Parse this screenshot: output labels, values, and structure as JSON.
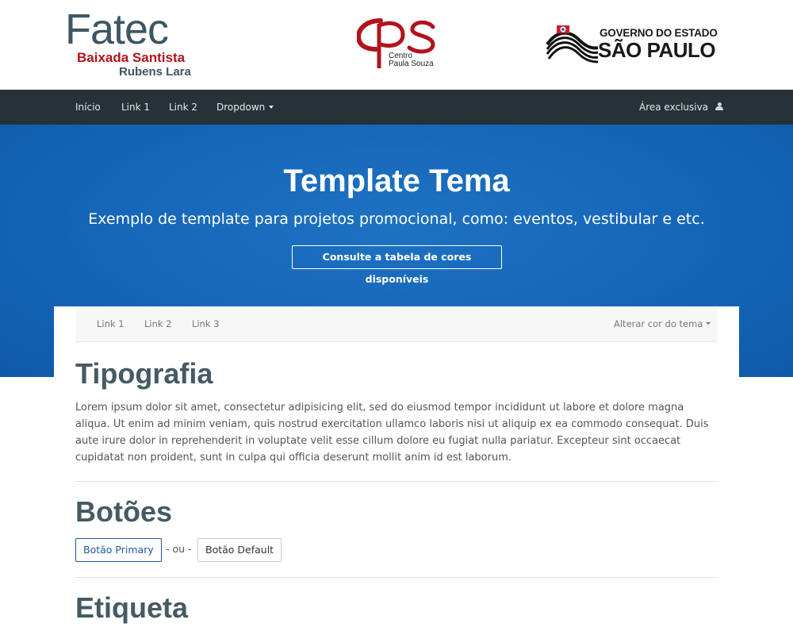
{
  "header": {
    "fatec_logo": {
      "word": "Fatec",
      "line1": "Baixada Santista",
      "line2": "Rubens Lara"
    },
    "cps_logo": {
      "line1": "Centro",
      "line2": "Paula Souza"
    },
    "sp_logo": {
      "line1": "GOVERNO DO ESTADO",
      "line2": "SÃO PAULO"
    }
  },
  "navbar": {
    "items": [
      {
        "label": "Início"
      },
      {
        "label": "Link 1"
      },
      {
        "label": "Link 2"
      },
      {
        "label": "Dropdown"
      }
    ],
    "right_label": "Área exclusiva"
  },
  "hero": {
    "title": "Template Tema",
    "subtitle": "Exemplo de template para projetos promocional, como: eventos, vestibular e etc.",
    "button_label": "Consulte a tabela de cores disponíveis"
  },
  "subnav": {
    "items": [
      {
        "label": "Link 1"
      },
      {
        "label": "Link 2"
      },
      {
        "label": "Link 3"
      }
    ],
    "right_label": "Alterar cor do tema"
  },
  "sections": {
    "tipografia": {
      "title": "Tipografia",
      "text": "Lorem ipsum dolor sit amet, consectetur adipisicing elit, sed do eiusmod tempor incididunt ut labore et dolore magna aliqua. Ut enim ad minim veniam, quis nostrud exercitation ullamco laboris nisi ut aliquip ex ea commodo consequat. Duis aute irure dolor in reprehenderit in voluptate velit esse cillum dolore eu fugiat nulla pariatur. Excepteur sint occaecat cupidatat non proident, sunt in culpa qui officia deserunt mollit anim id est laborum."
    },
    "botoes": {
      "title": "Botões",
      "primary_label": "Botão Primary",
      "separator": "- ou -",
      "default_label": "Botão Default"
    },
    "etiqueta": {
      "title": "Etiqueta"
    }
  },
  "colors": {
    "navbar_bg": "#263238",
    "hero_bg": "#1565b8",
    "heading": "#455a64",
    "fatec_red": "#b1131a",
    "cps_red": "#b0141c",
    "primary": "#1e5a9c"
  },
  "icons": {
    "dropdown": "caret-down-icon",
    "user": "user-icon",
    "sp_flag": "sp-flag-icon"
  }
}
